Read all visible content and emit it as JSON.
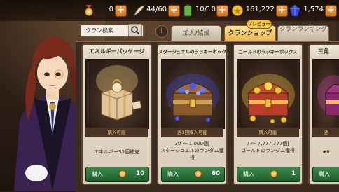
{
  "resources": {
    "medal": {
      "value": "0",
      "icon": "medal-icon"
    },
    "feather": {
      "value": "44/60",
      "icon": "feather-icon"
    },
    "battery": {
      "value": "10/10",
      "icon": "energy-battery-icon"
    },
    "gold": {
      "value": "161,222",
      "icon": "gold-coin-icon"
    },
    "gem": {
      "value": "1,574",
      "icon": "blue-gem-icon"
    }
  },
  "search": {
    "placeholder": "クラン検索"
  },
  "info_label": "i",
  "tabs": [
    {
      "label": "加入/結成",
      "active": false
    },
    {
      "label": "クランショップ",
      "active": true
    },
    {
      "label": "クランランキング",
      "active": false
    }
  ],
  "preview_badge": "プレビュー",
  "cards": [
    {
      "title": "エネルギーパッケージ",
      "status": "購入可能",
      "desc": [
        "エネルギー35個補充"
      ],
      "buy_label": "購入",
      "price": "10"
    },
    {
      "title": "スタージュエルのラッキーボックス",
      "status": "週1回購入可能",
      "desc": [
        "30 ～ 1,000個[",
        "スタージュエルのランダム獲得"
      ],
      "buy_label": "購入",
      "price": "60"
    },
    {
      "title": "ゴールドのラッキーボックス",
      "status": "購入可能",
      "desc": [
        "7 ～ 7,777,777個[",
        "ゴールドのランダム獲得"
      ],
      "buy_label": "購入",
      "price": "1"
    },
    {
      "title": "三角",
      "status": "週",
      "desc": [
        "★6"
      ],
      "buy_label": "購入",
      "price": ""
    }
  ],
  "colors": {
    "accent_gold": "#f5c640",
    "buy_green": "#2a7a3c",
    "plus_orange": "#e68a30"
  }
}
